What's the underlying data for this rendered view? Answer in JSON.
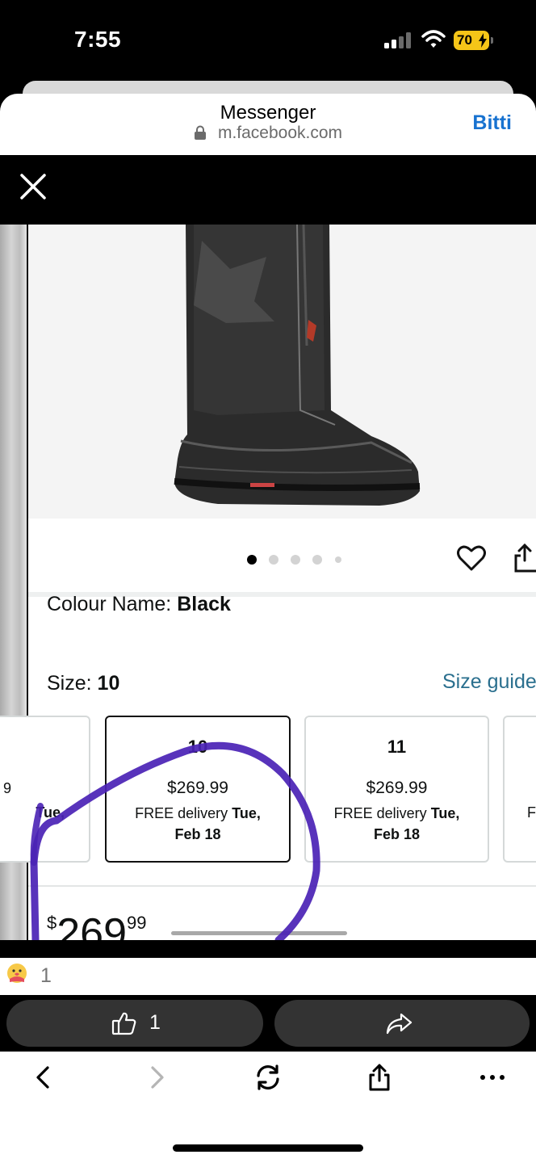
{
  "status_bar": {
    "time": "7:55",
    "battery": "70"
  },
  "browser": {
    "title": "Messenger",
    "url": "m.facebook.com",
    "done_label": "Bitti"
  },
  "product": {
    "colour_label": "Colour Name:",
    "colour_value": "Black",
    "size_label": "Size:",
    "size_value": "10",
    "size_guide_label": "Size guide",
    "partial_left_price": "9",
    "partial_left_delivery": "Tue,",
    "partial_right_delivery": "F",
    "size_cards": [
      {
        "size": "10",
        "price": "$269.99",
        "delivery_prefix": "FREE delivery",
        "delivery_day": "Tue,",
        "delivery_date": "Feb 18"
      },
      {
        "size": "11",
        "price": "$269.99",
        "delivery_prefix": "FREE delivery",
        "delivery_day": "Tue,",
        "delivery_date": "Feb 18"
      }
    ],
    "price_symbol": "$",
    "price_whole": "269",
    "price_cents": "99"
  },
  "reactions": {
    "count": "1"
  },
  "actions": {
    "like_count": "1"
  },
  "colors": {
    "accent": "#1772d0",
    "annotation": "#4a22b5",
    "battery": "#f5c518"
  }
}
